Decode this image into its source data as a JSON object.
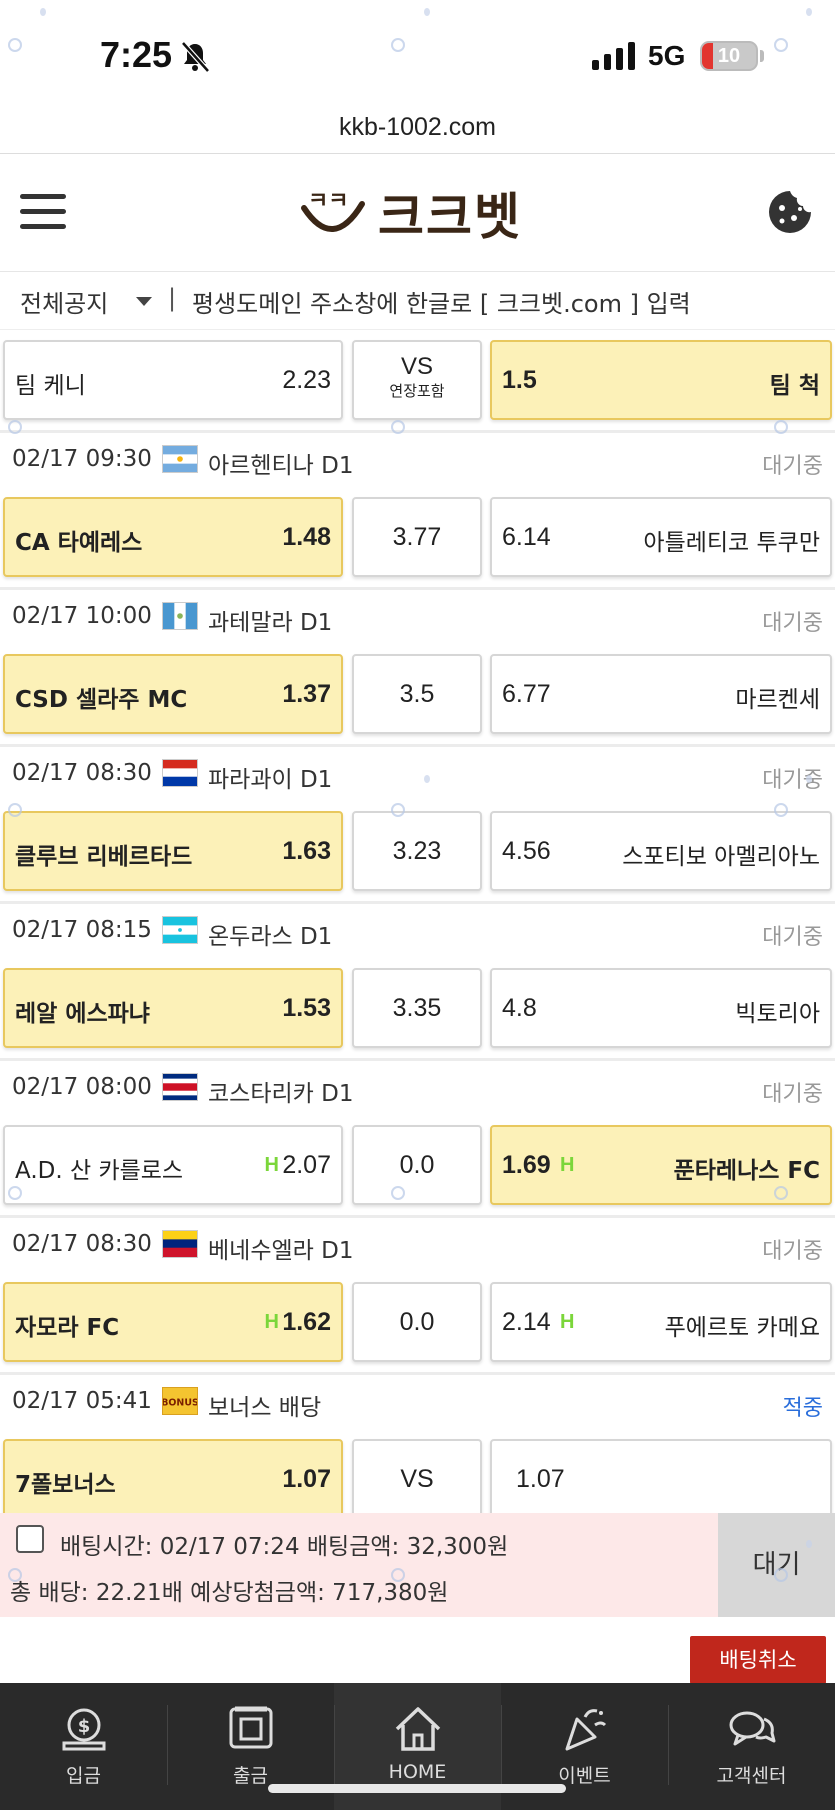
{
  "status_bar": {
    "time": "7:25",
    "network": "5G",
    "battery": "10"
  },
  "browser": {
    "url": "kkb-1002.com"
  },
  "header": {
    "logo_text": "크크벳",
    "logo_mark": "ㅋㅋ"
  },
  "notice": {
    "select_label": "전체공지",
    "separator": "|",
    "text": "평생도메인 주소창에 한글로 [ 크크벳.com ] 입력"
  },
  "bets": [
    {
      "home_team": "팀 케니",
      "home_odd": "2.23",
      "draw_label": "VS",
      "draw_sub": "연장포함",
      "away_odd": "1.5",
      "away_team": "팀 척",
      "selected": "away"
    },
    {
      "date": "02/17 09:30",
      "league": "아르헨티나 D1",
      "flag": "argentina",
      "status": "대기중",
      "home_team": "CA 타예레스",
      "home_odd": "1.48",
      "draw_odd": "3.77",
      "away_odd": "6.14",
      "away_team": "아틀레티코 투쿠만",
      "selected": "home"
    },
    {
      "date": "02/17 10:00",
      "league": "과테말라 D1",
      "flag": "guatemala",
      "status": "대기중",
      "home_team": "CSD 셀라주 MC",
      "home_odd": "1.37",
      "draw_odd": "3.5",
      "away_odd": "6.77",
      "away_team": "마르켄세",
      "selected": "home"
    },
    {
      "date": "02/17 08:30",
      "league": "파라과이 D1",
      "flag": "paraguay",
      "status": "대기중",
      "home_team": "클루브 리베르타드",
      "home_odd": "1.63",
      "draw_odd": "3.23",
      "away_odd": "4.56",
      "away_team": "스포티보 아멜리아노",
      "selected": "home"
    },
    {
      "date": "02/17 08:15",
      "league": "온두라스 D1",
      "flag": "honduras",
      "status": "대기중",
      "home_team": "레알 에스파냐",
      "home_odd": "1.53",
      "draw_odd": "3.35",
      "away_odd": "4.8",
      "away_team": "빅토리아",
      "selected": "home"
    },
    {
      "date": "02/17 08:00",
      "league": "코스타리카 D1",
      "flag": "costa-rica",
      "status": "대기중",
      "home_team": "A.D. 산 카를로스",
      "home_odd": "2.07",
      "home_handicap": "H",
      "draw_odd": "0.0",
      "away_odd": "1.69",
      "away_handicap": "H",
      "away_team": "푼타레나스 FC",
      "selected": "away"
    },
    {
      "date": "02/17 08:30",
      "league": "베네수엘라 D1",
      "flag": "venezuela",
      "status": "대기중",
      "home_team": "자모라 FC",
      "home_odd": "1.62",
      "home_handicap": "H",
      "draw_odd": "0.0",
      "away_odd": "2.14",
      "away_handicap": "H",
      "away_team": "푸에르토 카메요",
      "selected": "home"
    },
    {
      "date": "02/17 05:41",
      "league": "보너스 배당",
      "flag": "bonus",
      "flag_text": "BONUS",
      "status": "적중",
      "home_team": "7폴보너스",
      "home_odd": "1.07",
      "draw_odd": "VS",
      "away_odd": "1.07",
      "away_team": "",
      "selected": "home"
    }
  ],
  "summary": {
    "line1": "배팅시간: 02/17 07:24  배팅금액: 32,300원",
    "line2": "총 배당: 22.21배  예상당첨금액: 717,380원",
    "status_button": "대기",
    "cancel_button": "배팅취소"
  },
  "bottom_nav": [
    {
      "label": "입금",
      "icon": "deposit-icon"
    },
    {
      "label": "출금",
      "icon": "withdraw-icon"
    },
    {
      "label": "HOME",
      "icon": "home-icon"
    },
    {
      "label": "이벤트",
      "icon": "party-icon"
    },
    {
      "label": "고객센터",
      "icon": "chat-icon"
    }
  ],
  "colors": {
    "selected_bg": "#fcf1b8",
    "summary_bg": "#fde8e8",
    "cancel_red": "#c0271c",
    "nav_bg": "#2a2a2a",
    "handicap_green": "#7bd63a",
    "hit_blue": "#2a6edb"
  }
}
